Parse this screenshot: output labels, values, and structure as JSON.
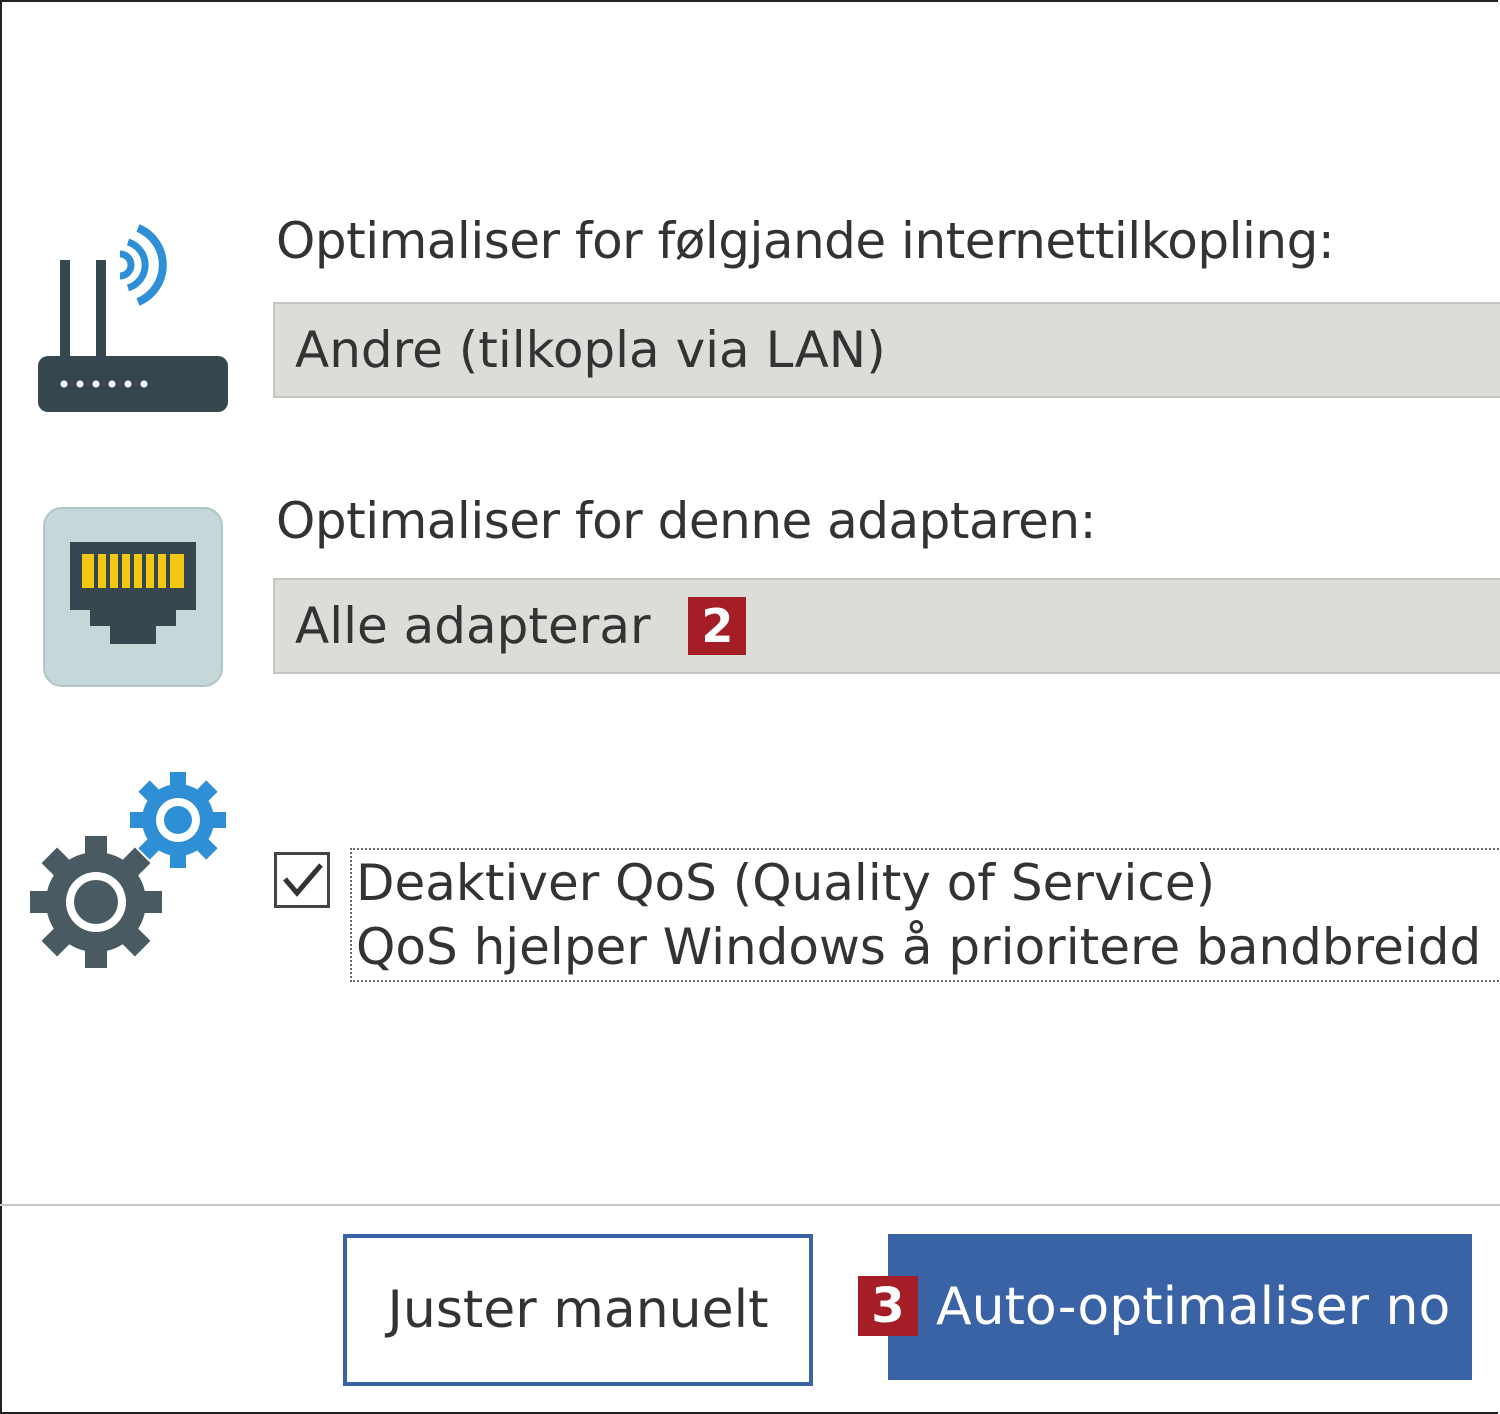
{
  "connection": {
    "label": "Optimaliser for følgjande internettilkopling:",
    "selected_value": "Andre (tilkopla via LAN)",
    "icon": "router-icon"
  },
  "adapter": {
    "label": "Optimaliser for denne adaptaren:",
    "selected_value": "Alle adapterar",
    "badge": "2",
    "icon": "ethernet-port-icon"
  },
  "qos": {
    "checked": true,
    "title": "Deaktiver QoS (Quality of Service)",
    "description": "QoS hjelper Windows å prioritere bandbreidd",
    "icon": "gears-icon"
  },
  "footer": {
    "manual_button_label": "Juster manuelt",
    "auto_button_label": "Auto-optimaliser no",
    "auto_badge": "3"
  },
  "colors": {
    "accent_blue": "#3a63a6",
    "badge_red": "#a51d25",
    "select_bg": "#dcdcd8",
    "icon_dark": "#37474f",
    "icon_blue": "#2e8fd6",
    "port_yellow": "#f2c811"
  }
}
